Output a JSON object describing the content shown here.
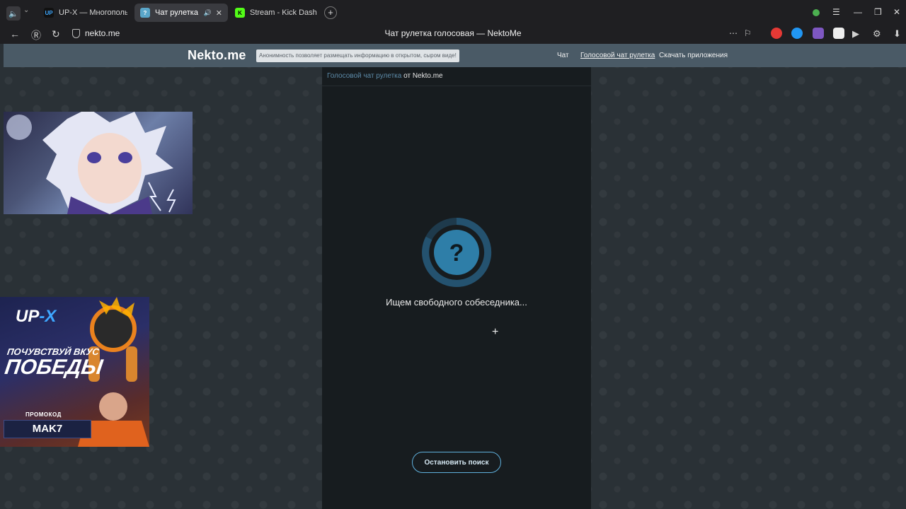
{
  "browser": {
    "tabs": [
      {
        "title": "UP-X — Многопользоват",
        "active": false
      },
      {
        "title": "Чат рулетка голосо",
        "active": true
      },
      {
        "title": "Stream - Kick Dashboard",
        "active": false
      }
    ],
    "url": "nekto.me",
    "page_title": "Чат рулетка голосовая — NektoMe"
  },
  "header": {
    "logo": "Nekto.me",
    "notice": "Анонимность позволяет размещать информацию в открытом, сыром виде!",
    "nav": [
      "Чат",
      "Голосовой чат рулетка",
      "Скачать приложения"
    ]
  },
  "panel": {
    "breadcrumb_link": "Голосовой чат рулетка",
    "breadcrumb_rest": " от Nekto.me",
    "searching_text": "Ищем свободного собеседника...",
    "stop_button": "Остановить поиск"
  },
  "overlays": {
    "upx_logo_main": "UP",
    "upx_logo_accent": "-X",
    "slogan_line1": "ПОЧУВСТВУЙ ВКУС",
    "slogan_line2": "ПОБЕДЫ",
    "promo_label": "ПРОМОКОД",
    "promo_code": "MAK7"
  },
  "colors": {
    "accent": "#5fb0dc",
    "header_bg": "#4a5a66",
    "panel_bg": "#171c1f"
  }
}
